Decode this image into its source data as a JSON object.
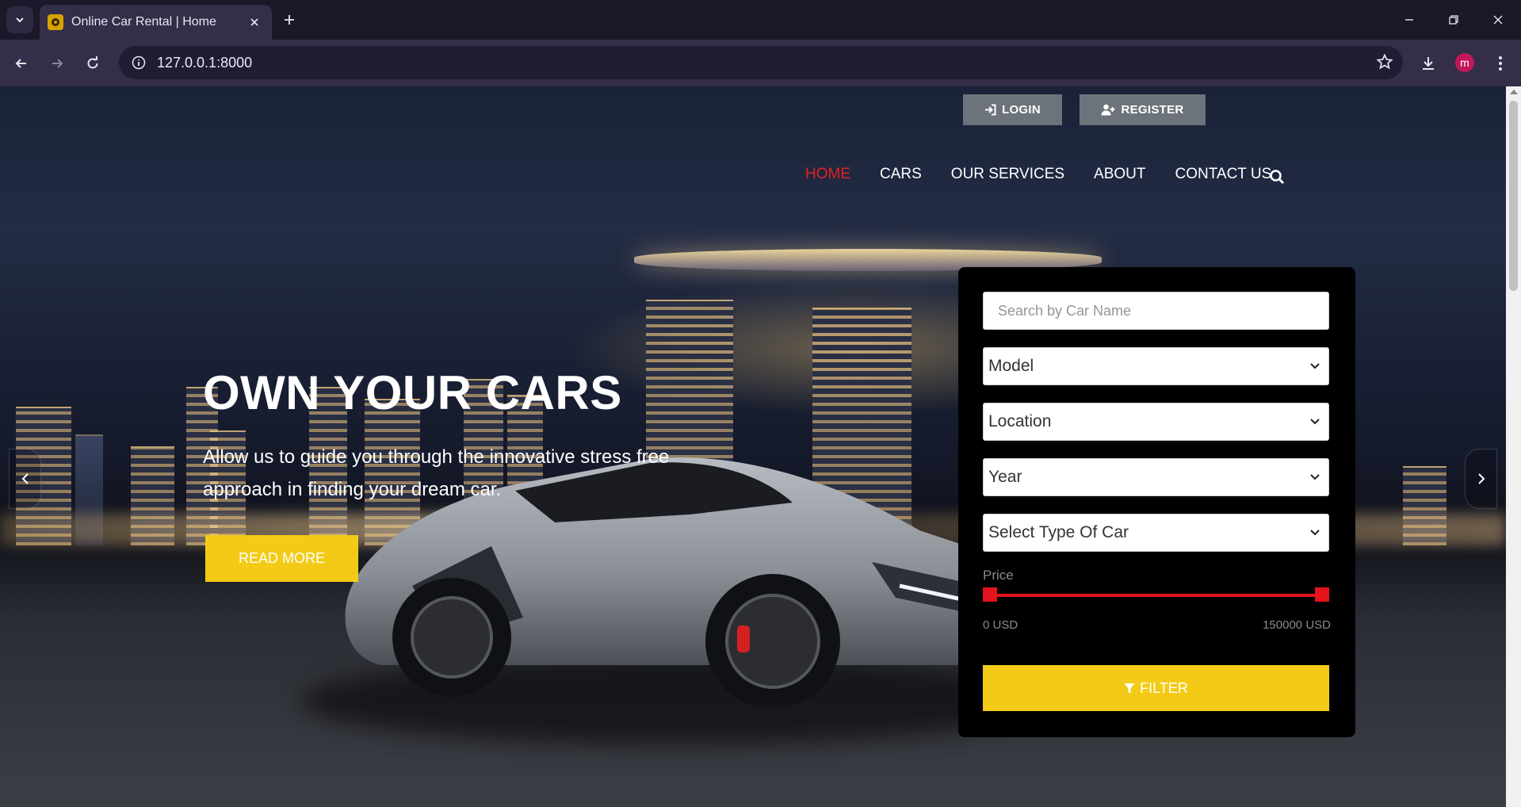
{
  "browser": {
    "tab_title": "Online Car Rental | Home",
    "url": "127.0.0.1:8000",
    "profile_initial": "m"
  },
  "auth": {
    "login_label": "LOGIN",
    "register_label": "REGISTER"
  },
  "nav": {
    "items": [
      {
        "label": "HOME",
        "active": true
      },
      {
        "label": "CARS",
        "active": false
      },
      {
        "label": "OUR SERVICES",
        "active": false
      },
      {
        "label": "ABOUT",
        "active": false
      },
      {
        "label": "CONTACT US",
        "active": false
      }
    ]
  },
  "hero": {
    "title": "OWN YOUR CARS",
    "subtitle": "Allow us to guide you through the innovative stress free approach in finding your dream car.",
    "cta_label": "READ MORE"
  },
  "filter": {
    "search_placeholder": "Search by Car Name",
    "model_label": "Model",
    "location_label": "Location",
    "year_label": "Year",
    "type_label": "Select Type Of Car",
    "price_label": "Price",
    "price_min": "0 USD",
    "price_max": "150000 USD",
    "button_label": "FILTER"
  },
  "colors": {
    "accent_yellow": "#f3cb17",
    "accent_red": "#e3141b",
    "nav_active": "#e22222"
  }
}
